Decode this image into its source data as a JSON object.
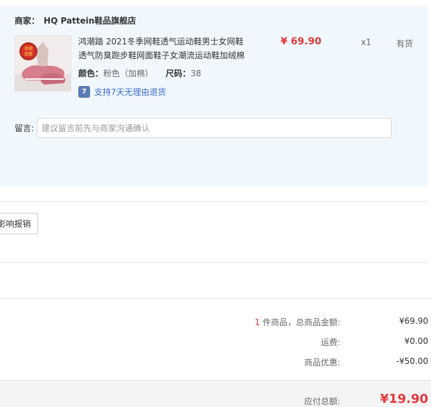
{
  "shop": {
    "label": "商家",
    "colon": "：",
    "name": "HQ Pattein鞋品旗舰店"
  },
  "product": {
    "thumbnail_badge": "毛绒加厚",
    "title": "鸿潮踏 2021冬季网鞋透气运动鞋男士女网鞋透气防臭跑步鞋网面鞋子女潮流运动鞋加绒棉",
    "price": "¥ 69.90",
    "quantity": "x1",
    "stock": "有货",
    "color_label": "颜色：",
    "color_value": "粉色（加棉）",
    "size_label": "尺码：",
    "size_value": "38",
    "return_icon": "7",
    "return_text": "支持7天无理由退货"
  },
  "message": {
    "label": "留言:",
    "placeholder": "建议留言前先与商家沟通确认"
  },
  "invoice": {
    "button_label": "影响报销"
  },
  "summary": {
    "items_count": "1",
    "items_label": " 件商品，总商品金额:",
    "items_value": "¥69.90",
    "shipping_label": "运费:",
    "shipping_value": "¥0.00",
    "discount_label": "商品优惠:",
    "discount_value": "-¥50.00",
    "total_label": "应付总额:",
    "total_value": "¥19.90"
  },
  "colors": {
    "accent_red": "#e4393c",
    "panel_bg": "#f1f8fd",
    "link_blue": "#3a6cc9"
  },
  "icons": {
    "return_icon": "seven-day-return-icon"
  }
}
